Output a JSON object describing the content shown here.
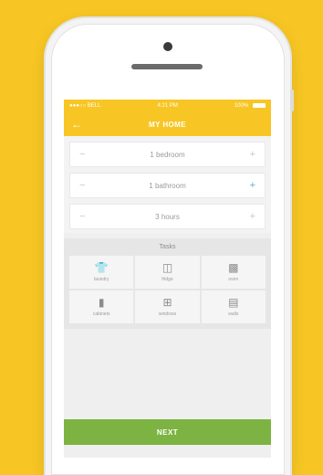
{
  "statusbar": {
    "carrier": "●●●○○ BELL",
    "time": "4:21 PM",
    "battery": "100%"
  },
  "header": {
    "back_icon": "arrow-left-icon",
    "title": "MY HOME"
  },
  "steppers": [
    {
      "value": "1 bedroom",
      "minus": "−",
      "plus": "+"
    },
    {
      "value": "1 bathroom",
      "minus": "−",
      "plus": "+"
    },
    {
      "value": "3 hours",
      "minus": "−",
      "plus": "+"
    }
  ],
  "tasks": {
    "title": "Tasks",
    "items": [
      {
        "label": "laundry",
        "icon": "shirt-icon"
      },
      {
        "label": "fridge",
        "icon": "fridge-icon"
      },
      {
        "label": "oven",
        "icon": "oven-icon"
      },
      {
        "label": "cabinets",
        "icon": "cabinet-icon"
      },
      {
        "label": "windows",
        "icon": "window-icon"
      },
      {
        "label": "walls",
        "icon": "wall-icon"
      }
    ]
  },
  "footer": {
    "next_label": "NEXT"
  },
  "colors": {
    "accent": "#f7c624",
    "button": "#7cb342"
  }
}
